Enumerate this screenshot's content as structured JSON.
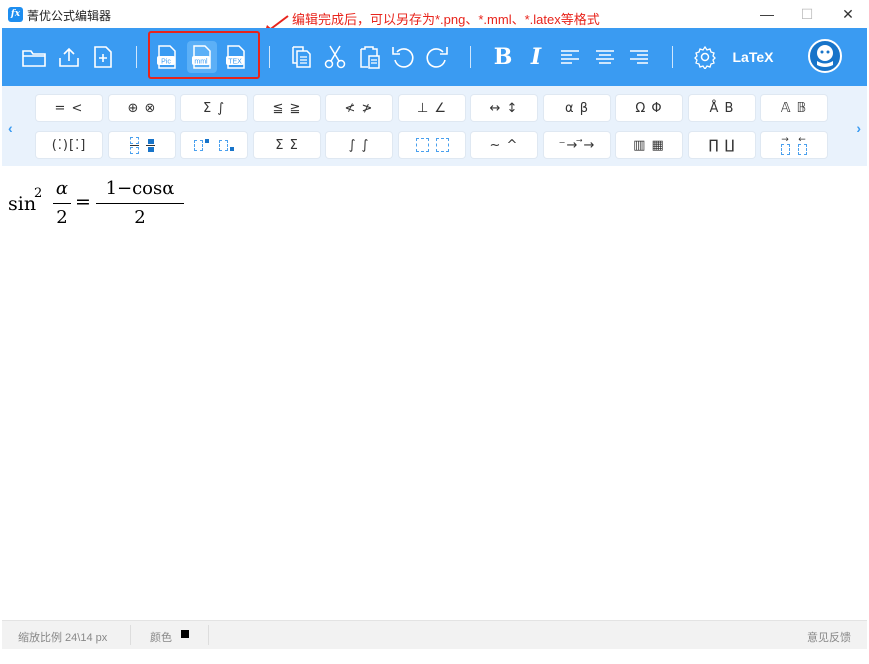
{
  "window": {
    "title": "菁优公式编辑器",
    "logo_text": "fx",
    "minimize": "—",
    "maximize": "☐",
    "close": "✕"
  },
  "annotation": "编辑完成后，可以另存为*.png、*.mml、*.latex等格式",
  "toolbar": {
    "export_png_label": "Pic",
    "export_mml_label": "mml",
    "export_tex_label": "TEX",
    "bold_label": "B",
    "italic_label": "I",
    "latex_label": "LaTeX",
    "accent_color": "#3a9bf2",
    "highlight_color": "#e8241c"
  },
  "palette": {
    "row1": [
      "= <",
      "⊕ ⊗",
      "Σ ∫",
      "≦ ≧",
      "≮ ≯",
      "⊥ ∠",
      "↔ ↕",
      "α β",
      "Ω Φ",
      "Å B",
      "𝔸 𝔹"
    ],
    "row2": [
      "() []",
      "frac",
      "sup sub",
      "Σ Σ",
      "∫ ∫",
      "□ □",
      "~ ^",
      "- →",
      "matrix",
      "Π Π",
      "vec"
    ],
    "row2_display": [
      "(⁚)[⁚]",
      "",
      "",
      "Σ Σ",
      "∫ ∫",
      "⎾ ⏋",
      "~ ^",
      "⁻→ ⃗→",
      "▥ ▦",
      "∏ ∐",
      "⃗ ⃖"
    ],
    "left_arrow": "‹",
    "right_arrow": "›"
  },
  "formula": {
    "func": "sin",
    "exp": "2",
    "frac1_num": "α",
    "frac1_den": "2",
    "eq": "=",
    "frac2_num": "1−cosα",
    "frac2_den": "2"
  },
  "status": {
    "zoom": "缩放比例 24\\14 px",
    "color_label": "颜色",
    "feedback": "意见反馈"
  }
}
